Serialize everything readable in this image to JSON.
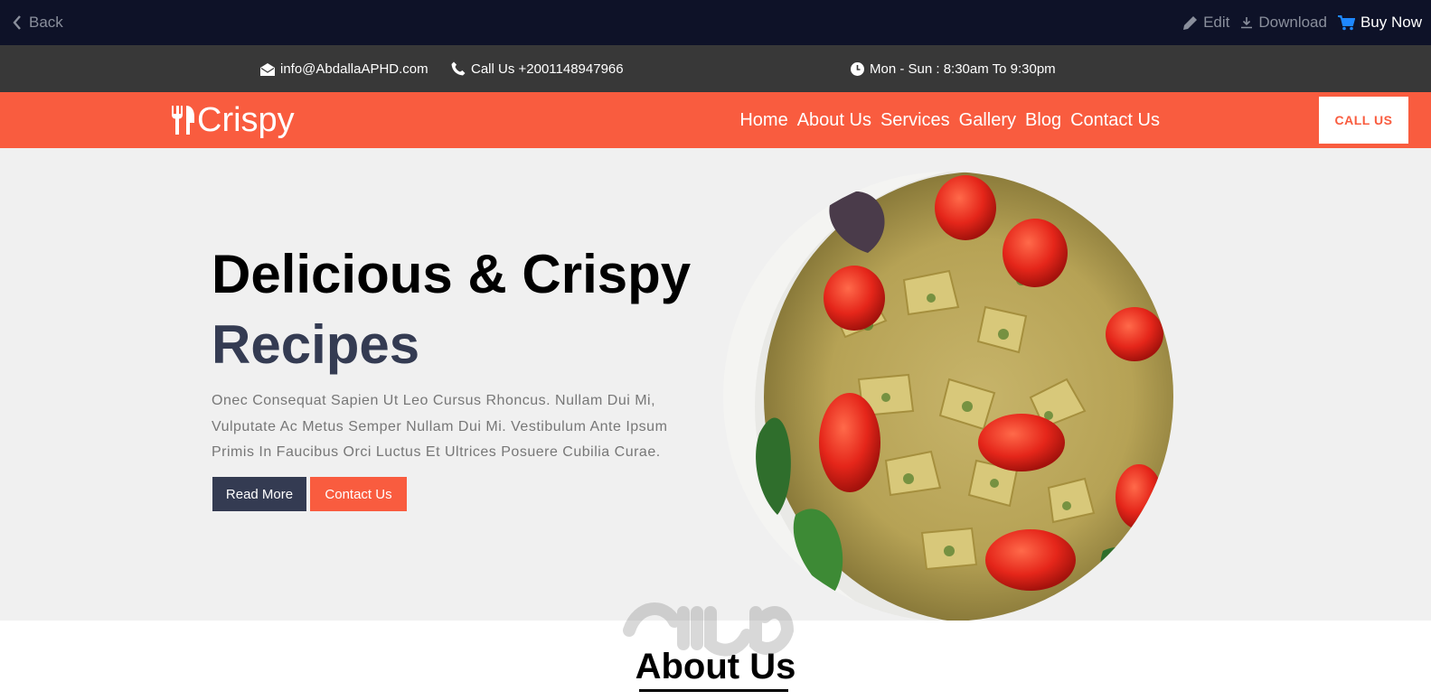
{
  "preview_bar": {
    "back_label": "Back",
    "edit_label": "Edit",
    "download_label": "Download",
    "buy_label": "Buy Now"
  },
  "info_bar": {
    "email": "info@AbdallaAPHD.com",
    "phone": "Call Us +2001148947966",
    "hours": "Mon - Sun : 8:30am To 9:30pm"
  },
  "nav": {
    "logo_text": "Crispy",
    "items": [
      "Home",
      "About Us",
      "Services",
      "Gallery",
      "Blog",
      "Contact Us"
    ],
    "call_button": "CALL US"
  },
  "hero": {
    "title_line1": "Delicious & Crispy",
    "title_line2": "Recipes",
    "description": "Onec Consequat Sapien Ut Leo Cursus Rhoncus. Nullam Dui Mi, Vulputate Ac Metus Semper Nullam Dui Mi. Vestibulum Ante Ipsum Primis In Faucibus Orci Luctus Et Ultrices Posuere Cubilia Curae.",
    "read_more": "Read More",
    "contact_us": "Contact Us"
  },
  "about": {
    "title": "About Us"
  },
  "watermark_text": "مستقل mostaql.com",
  "colors": {
    "preview_bar_bg": "#0e1228",
    "info_bar_bg": "#383838",
    "brand_orange": "#f95c3f",
    "dark_navy": "#343b52",
    "hero_bg": "#f0f0f0"
  },
  "icons": {
    "back": "chevron-left-icon",
    "edit": "pencil-icon",
    "download": "download-icon",
    "buy": "cart-icon",
    "email": "envelope-open-icon",
    "phone": "phone-icon",
    "hours": "clock-icon",
    "logo": "fork-knife-icon"
  }
}
